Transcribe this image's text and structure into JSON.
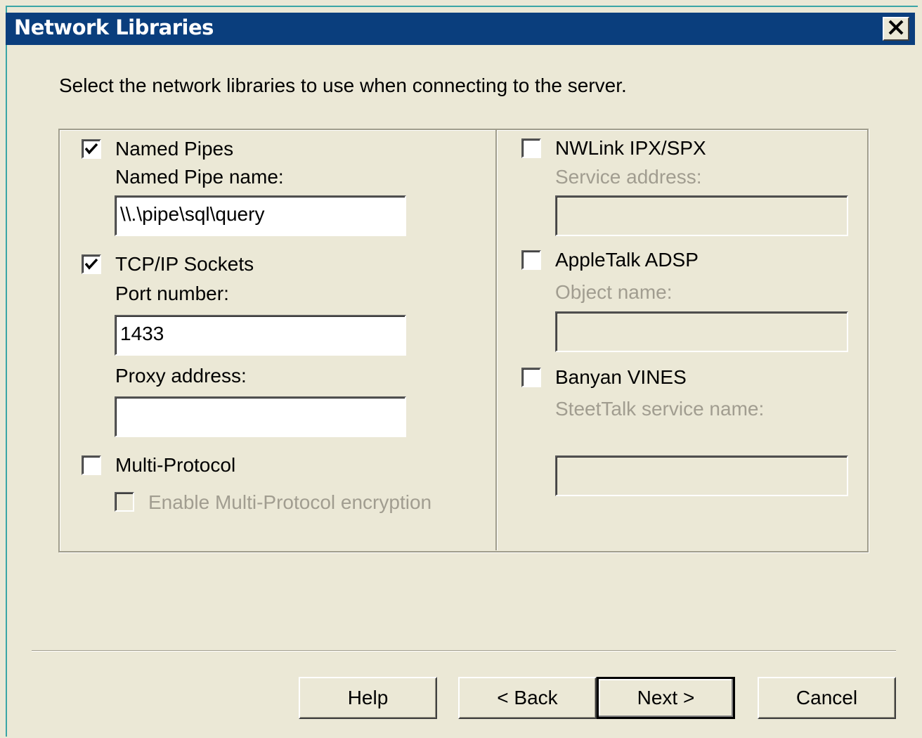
{
  "window": {
    "title": "Network Libraries",
    "close_symbol": "close-icon"
  },
  "instruction": "Select the network libraries to use when connecting to the server.",
  "left": {
    "named_pipes": {
      "label": "Named Pipes",
      "checked": true,
      "name_label": "Named Pipe name:",
      "name_value": "\\\\.\\pipe\\sql\\query"
    },
    "tcpip": {
      "label": "TCP/IP Sockets",
      "checked": true,
      "port_label": "Port number:",
      "port_value": "1433",
      "proxy_label": "Proxy address:",
      "proxy_value": ""
    },
    "multiprotocol": {
      "label": "Multi-Protocol",
      "checked": false,
      "encryption_label": "Enable Multi-Protocol encryption",
      "encryption_checked": false
    }
  },
  "right": {
    "nwlink": {
      "label": "NWLink IPX/SPX",
      "checked": false,
      "service_label": "Service address:",
      "service_value": ""
    },
    "appletalk": {
      "label": "AppleTalk ADSP",
      "checked": false,
      "object_label": "Object name:",
      "object_value": ""
    },
    "banyan": {
      "label": "Banyan VINES",
      "checked": false,
      "streettalk_label": "SteetTalk service name:",
      "streettalk_value": ""
    }
  },
  "buttons": {
    "help": "Help",
    "back": "< Back",
    "next": "Next >",
    "cancel": "Cancel"
  }
}
